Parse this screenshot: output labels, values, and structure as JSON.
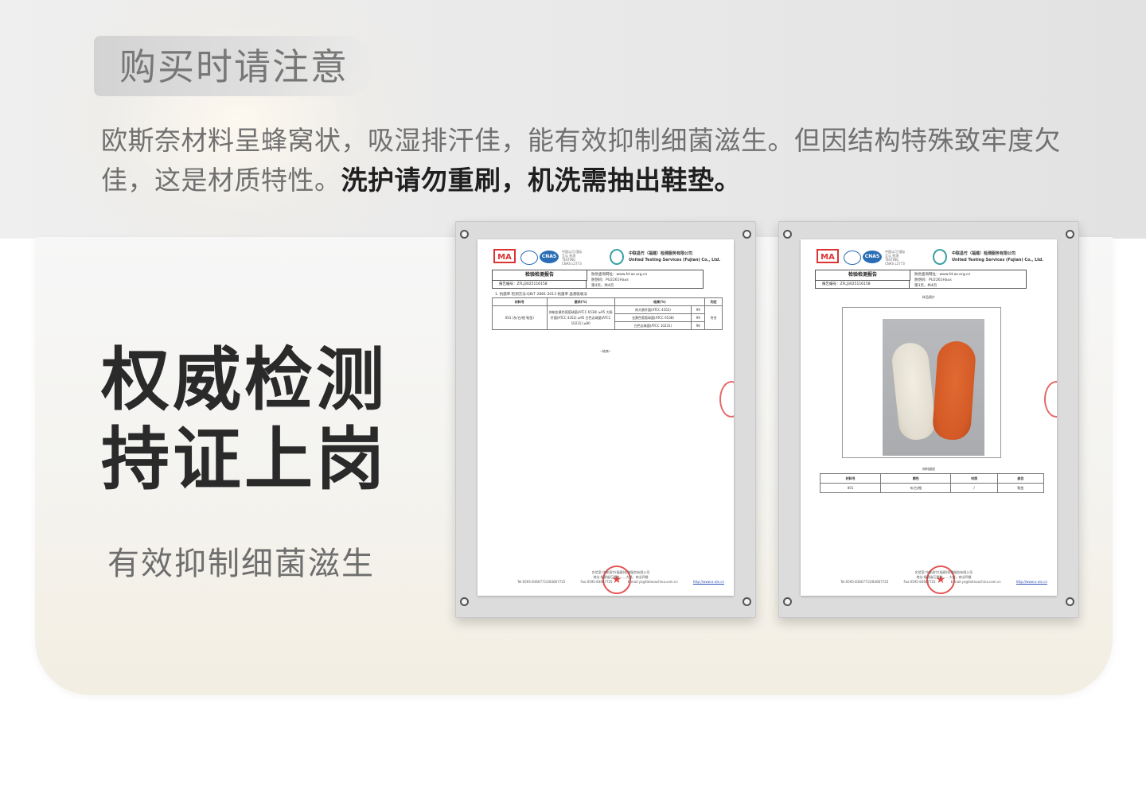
{
  "notice": {
    "title": "购买时请注意",
    "text_normal": "欧斯奈材料呈蜂窝状，吸湿排汗佳，能有效抑制细菌滋生。但因结构特殊致牢度欠佳，这是材质特性。",
    "text_emphasis": "洗护请勿重刷，机洗需抽出鞋垫。"
  },
  "feature": {
    "headline_line1": "权威检测",
    "headline_line2": "持证上岗",
    "subtitle": "有效抑制细菌滋生"
  },
  "report": {
    "logo_ma": "MA",
    "logo_cnas": "CNAS",
    "accreditation_text": "中国认可 国际互认 检测 TESTING CNAS L5773",
    "company_cn": "中联昌竹（福建）检测服务有限公司",
    "company_en": "United Testing Services (Fujian) Co., Ltd.",
    "title": "检验检测报告",
    "report_no_label": "报告编号：ZFLJ3025116158",
    "query_site": "防伪查询网址：www.fd-az.org.cn",
    "query_code": "防伪码：PU2261Haus",
    "page_1": "第4页，共4页",
    "page_2": "第3页，共4页",
    "section_1": "1.  抗菌率  检测方法:QB/T 2881-2013  抗菌率 晶液吸收法",
    "table_headers": [
      "材料号",
      "要求(%)",
      "结果(%)",
      "判定"
    ],
    "table_row": {
      "material": "001 (灰/白/橙  鞋垫)",
      "requirement": "抑制金黄色葡萄球菌(ATCC 6538) ≥95 大肠杆菌(ATCC 4352) ≥95 白色念珠菌(ATCC 10231) ≥80",
      "results": [
        {
          "item": "抑大肠杆菌(ATCC 4352)",
          "value": "99"
        },
        {
          "item": "金黄色葡萄球菌(ATCC 6538)",
          "value": "99"
        },
        {
          "item": "白色念珠菌(ATCC 10231)",
          "value": "96"
        }
      ],
      "verdict": "符合"
    },
    "end_mark": "--结束--",
    "footer_lab": "实验室:中联昌竹(福建)检测服务有限公司",
    "footer_addr": "地址:福建省石狮市……大楼，商业四楼",
    "footer_tel": "Tel:0595-83667715/83667725",
    "footer_fax": "Fax:0595-83667725",
    "footer_email": "E-mail:ys@fatinoochina.com.cn",
    "footer_web": "http://www.o-uts.cn",
    "photo_caption": "样品照片",
    "material_caption": "材料描述",
    "table2_headers": [
      "材料号",
      "颜色",
      "材质",
      "部位"
    ],
    "table2_row": [
      "001",
      "灰/白/橙",
      "/",
      "鞋垫"
    ],
    "stamp_symbol": "★"
  },
  "colors": {
    "headline": "#2a2a2a",
    "body_text": "#707070",
    "emphasis": "#1f1f1f",
    "stamp_red": "#dc2828",
    "insole_orange": "#d45a26"
  }
}
